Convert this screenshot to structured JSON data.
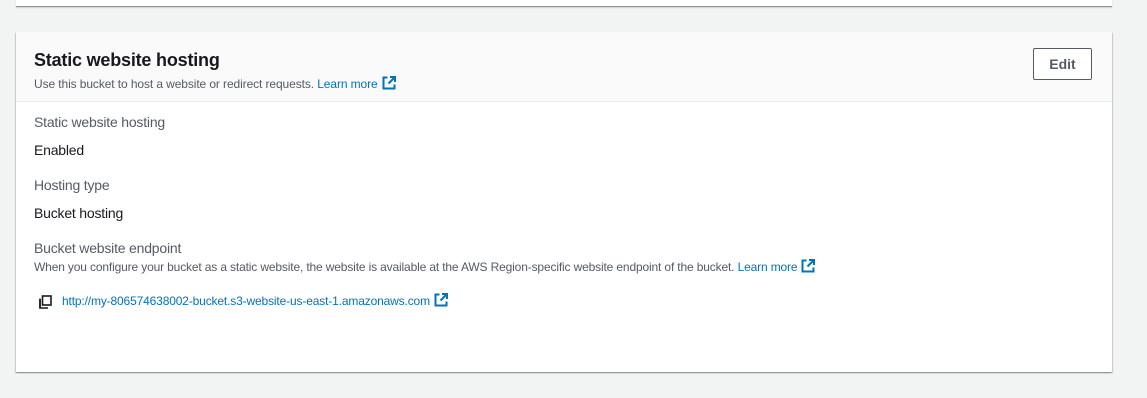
{
  "panel": {
    "title": "Static website hosting",
    "description": "Use this bucket to host a website or redirect requests.",
    "learn_more": "Learn more",
    "edit_label": "Edit"
  },
  "fields": {
    "hosting": {
      "label": "Static website hosting",
      "value": "Enabled"
    },
    "hosting_type": {
      "label": "Hosting type",
      "value": "Bucket hosting"
    },
    "endpoint": {
      "label": "Bucket website endpoint",
      "description": "When you configure your bucket as a static website, the website is available at the AWS Region-specific website endpoint of the bucket.",
      "learn_more": "Learn more",
      "url": "http://my-806574638002-bucket.s3-website-us-east-1.amazonaws.com"
    }
  },
  "icons": {
    "external": "external-link-icon",
    "copy": "copy-icon"
  },
  "colors": {
    "link": "#0073bb",
    "label": "#545b64",
    "text": "#16191f",
    "header_bg": "#fafafa",
    "page_bg": "#f2f3f3"
  }
}
